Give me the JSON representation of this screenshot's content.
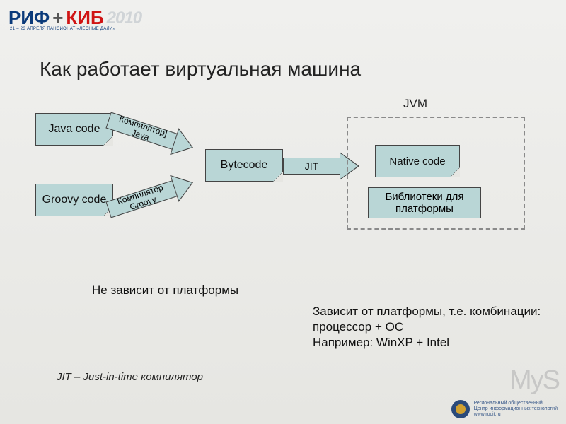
{
  "header": {
    "logo_rif": "РИФ",
    "logo_plus": "+",
    "logo_kib": "КИБ",
    "logo_year": "2010",
    "logo_sub": "21 – 23 АПРЕЛЯ   ПАНСИОНАТ «ЛЕСНЫЕ ДАЛИ»"
  },
  "title": "Как работает виртуальная машина",
  "diagram": {
    "java_code": "Java code",
    "groovy_code": "Groovy code",
    "compiler_java": "Компилятор] Java",
    "compiler_groovy": "Компилятор Groovy",
    "bytecode": "Bytecode",
    "jit": "JIT",
    "native_code": "Native code",
    "libs": "Библиотеки для платформы",
    "jvm_label": "JVM"
  },
  "notes": {
    "independent": "Не зависит от платформы",
    "dependent": "Зависит от платформы, т.е. комбинации: процессор + ОС\nНапример: WinXP + Intel",
    "jit_def": "JIT – Just-in-time компилятор"
  },
  "watermark": "MyS",
  "footer": {
    "org": "Региональный общественный\nЦентр информационных технологий\nwww.rocit.ru"
  },
  "colors": {
    "box_fill": "#b9d6d6",
    "box_border": "#444444",
    "logo_blue": "#0a3a7a",
    "logo_red": "#d01414"
  }
}
